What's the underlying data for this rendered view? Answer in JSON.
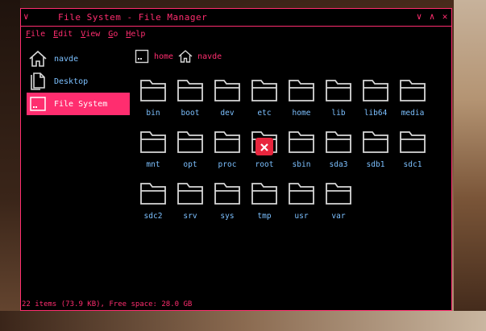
{
  "window": {
    "title": "File System - File Manager",
    "controls": [
      "∨",
      "∧",
      "✕"
    ]
  },
  "menu": [
    {
      "accel": "F",
      "rest": "ile"
    },
    {
      "accel": "E",
      "rest": "dit"
    },
    {
      "accel": "V",
      "rest": "iew"
    },
    {
      "accel": "G",
      "rest": "o"
    },
    {
      "accel": "H",
      "rest": "elp"
    }
  ],
  "sidebar": {
    "items": [
      {
        "label": "navde",
        "icon": "home-icon"
      },
      {
        "label": "Desktop",
        "icon": "documents-icon"
      },
      {
        "label": "File System",
        "icon": "drive-icon",
        "active": true
      }
    ]
  },
  "breadcrumb": {
    "items": [
      {
        "label": "home",
        "icon": "drive-icon"
      },
      {
        "label": "navde",
        "icon": "home-icon"
      }
    ]
  },
  "files": [
    {
      "name": "bin"
    },
    {
      "name": "boot"
    },
    {
      "name": "dev"
    },
    {
      "name": "etc"
    },
    {
      "name": "home"
    },
    {
      "name": "lib"
    },
    {
      "name": "lib64"
    },
    {
      "name": "media"
    },
    {
      "name": "mnt"
    },
    {
      "name": "opt"
    },
    {
      "name": "proc"
    },
    {
      "name": "root",
      "locked": true
    },
    {
      "name": "sbin"
    },
    {
      "name": "sda3"
    },
    {
      "name": "sdb1"
    },
    {
      "name": "sdc1"
    },
    {
      "name": "sdc2"
    },
    {
      "name": "srv"
    },
    {
      "name": "sys"
    },
    {
      "name": "tmp"
    },
    {
      "name": "usr"
    },
    {
      "name": "var"
    }
  ],
  "status": "22 items (73.9 KB), Free space: 28.0 GB",
  "colors": {
    "accent": "#ff2d6f",
    "text": "#7cc0ff",
    "icon": "#d8d8d8",
    "locked": "#e8263e"
  }
}
